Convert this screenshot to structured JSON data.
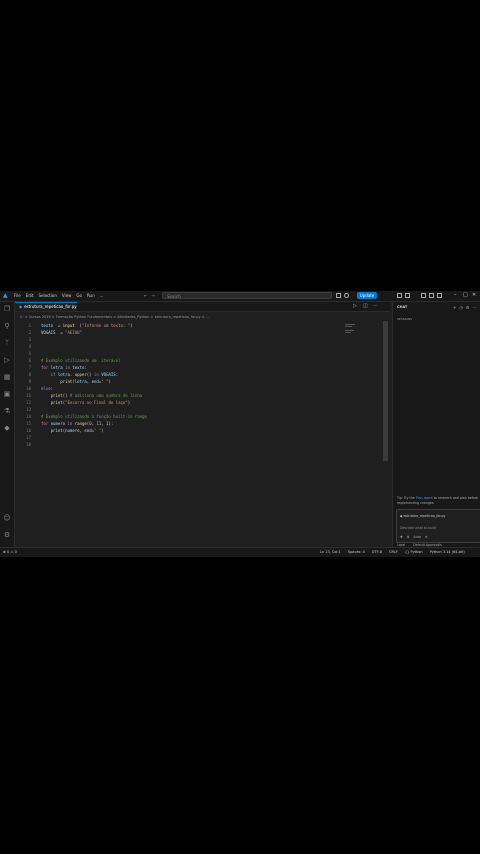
{
  "menu": [
    "File",
    "Edit",
    "Selection",
    "View",
    "Go",
    "Run",
    "..."
  ],
  "search_placeholder": "Search",
  "update_label": "Update",
  "tab": {
    "label": "estrutura_repeticao_for.py",
    "icon": "python-icon"
  },
  "breadcrumb": "C: > Cursos 2025 > Formação Python Fundamentals > Atividades_Python > estrutura_repeticao_for.py > ...",
  "code_lines": [
    {
      "n": "1",
      "parts": [
        [
          "var",
          "texto"
        ],
        [
          "",
          "  = "
        ],
        [
          "fn",
          "input"
        ],
        [
          "",
          "  ("
        ],
        [
          "str",
          "\"Informe um texto: \""
        ],
        [
          "",
          ")"
        ]
      ]
    },
    {
      "n": "2",
      "parts": [
        [
          "var",
          "VOGAIS"
        ],
        [
          "",
          "  = "
        ],
        [
          "str",
          "\"AEIOU\""
        ]
      ]
    },
    {
      "n": "3",
      "parts": []
    },
    {
      "n": "4",
      "parts": []
    },
    {
      "n": "5",
      "parts": []
    },
    {
      "n": "6",
      "parts": [
        [
          "cm",
          "# Exemplo utilizando um  iterável"
        ]
      ]
    },
    {
      "n": "7",
      "parts": [
        [
          "kw",
          "for"
        ],
        [
          "",
          ""
        ],
        [
          "var",
          " letra"
        ],
        [
          "kw",
          " in"
        ],
        [
          "var",
          " texto"
        ],
        [
          "",
          ":"
        ]
      ]
    },
    {
      "n": "8",
      "parts": [
        [
          "kw",
          "    if"
        ],
        [
          "var",
          " letra"
        ],
        [
          "",
          ". "
        ],
        [
          "fn",
          "upper"
        ],
        [
          "",
          "() "
        ],
        [
          "kw2",
          "in"
        ],
        [
          "var",
          " VOGAIS"
        ],
        [
          "",
          ":"
        ]
      ]
    },
    {
      "n": "9",
      "parts": [
        [
          "fn",
          "        print"
        ],
        [
          "",
          "("
        ],
        [
          "var",
          "letra"
        ],
        [
          "",
          ", "
        ],
        [
          "var",
          "end"
        ],
        [
          "",
          "="
        ],
        [
          "str",
          "\" \""
        ],
        [
          "",
          ")"
        ]
      ]
    },
    {
      "n": "10",
      "parts": [
        [
          "kw",
          "else"
        ],
        [
          "",
          ":"
        ]
      ]
    },
    {
      "n": "11",
      "parts": [
        [
          "fn",
          "    print"
        ],
        [
          "",
          "() "
        ],
        [
          "cm",
          "# adiciona uma quebra de linha"
        ]
      ]
    },
    {
      "n": "12",
      "parts": [
        [
          "fn",
          "    print"
        ],
        [
          "",
          "("
        ],
        [
          "str",
          "\"Encerra no Final do laço\""
        ],
        [
          "",
          ")"
        ]
      ]
    },
    {
      "n": "13",
      "parts": []
    },
    {
      "n": "14",
      "parts": [
        [
          "cm",
          "# Exemplo utilizando a função built-in range"
        ]
      ]
    },
    {
      "n": "15",
      "parts": [
        [
          "kw",
          "for"
        ],
        [
          "var",
          " numero"
        ],
        [
          "kw",
          " in"
        ],
        [
          "fn",
          " range"
        ],
        [
          "",
          "("
        ],
        [
          "num",
          "0"
        ],
        [
          "",
          ", "
        ],
        [
          "num",
          "11"
        ],
        [
          "",
          ", "
        ],
        [
          "num",
          "1"
        ],
        [
          "",
          "):"
        ]
      ]
    },
    {
      "n": "16",
      "parts": [
        [
          "fn",
          "    print"
        ],
        [
          "",
          "("
        ],
        [
          "var",
          "numero"
        ],
        [
          "",
          ", "
        ],
        [
          "var",
          "end"
        ],
        [
          "",
          "="
        ],
        [
          "str",
          "\" \""
        ],
        [
          "",
          ")"
        ]
      ]
    },
    {
      "n": "17",
      "parts": []
    },
    {
      "n": "18",
      "parts": []
    }
  ],
  "chat": {
    "header": "CHAT",
    "sessions": "SESSIONS",
    "tip_prefix": "Tip: Try the ",
    "tip_link": "Plan agent",
    "tip_suffix": " to research and plan before implementing changes.",
    "file_chip": "estrutura_repeticao_for.py",
    "placeholder": "Describe what to build",
    "agent_label": "Auto",
    "footer_local": "Local",
    "footer_approvals": "Default Approvals"
  },
  "status": {
    "left": "⊗ 0 ⚠ 0",
    "position": "Ln 13, Col 1",
    "spaces": "Spaces: 4",
    "encoding": "UTF-8",
    "eol": "CRLF",
    "language": "{} Python",
    "interpreter": "Python 3.14 (64-bit)"
  },
  "colors": {
    "accent": "#0078d4",
    "background": "#1f1f1f"
  }
}
